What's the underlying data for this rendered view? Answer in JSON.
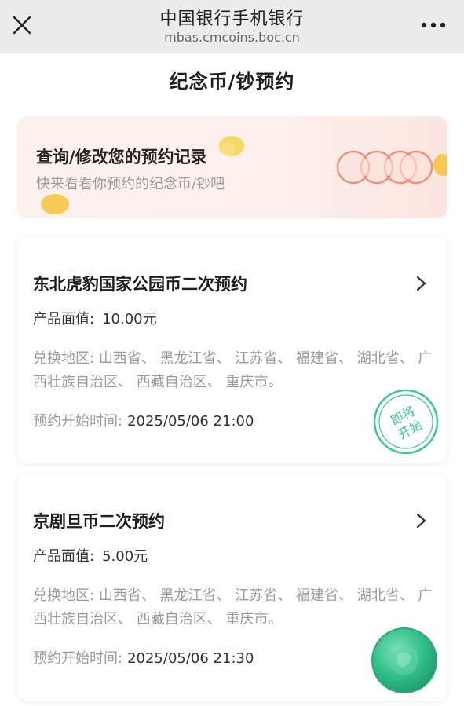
{
  "topbar": {
    "title": "中国银行手机银行",
    "url": "mbas.cmcoins.boc.cn",
    "close_icon": "close-icon",
    "more_icon": "more-horizontal-icon"
  },
  "page": {
    "title": "纪念币/钞预约"
  },
  "promo": {
    "title": "查询/修改您的预约记录",
    "subtitle": "快来看看你预约的纪念币/钞吧",
    "accent": "#f3a08a",
    "coin_color": "#f6c33a"
  },
  "cards": [
    {
      "title": "东北虎豹国家公园币二次预约",
      "face_label": "产品面值:",
      "face_value": "10.00元",
      "region_label": "兑换地区:",
      "region_value": "山西省、 黑龙江省、 江苏省、 福建省、 湖北省、 广西壮族自治区、 西藏自治区、 重庆市。",
      "start_label": "预约开始时间:",
      "start_time": "2025/05/06 21:00",
      "stamp_line1": "即将",
      "stamp_line2": "开始",
      "stamp_color": "#3cc49a"
    },
    {
      "title": "京剧旦币二次预约",
      "face_label": "产品面值:",
      "face_value": "5.00元",
      "region_label": "兑换地区:",
      "region_value": "山西省、 黑龙江省、 江苏省、 福建省、 湖北省、 广西壮族自治区、 西藏自治区、 重庆市。",
      "start_label": "预约开始时间:",
      "start_time": "2025/05/06 21:30"
    }
  ],
  "colors": {
    "topbar_bg": "#ececec",
    "fab_green": "#33c08a"
  }
}
